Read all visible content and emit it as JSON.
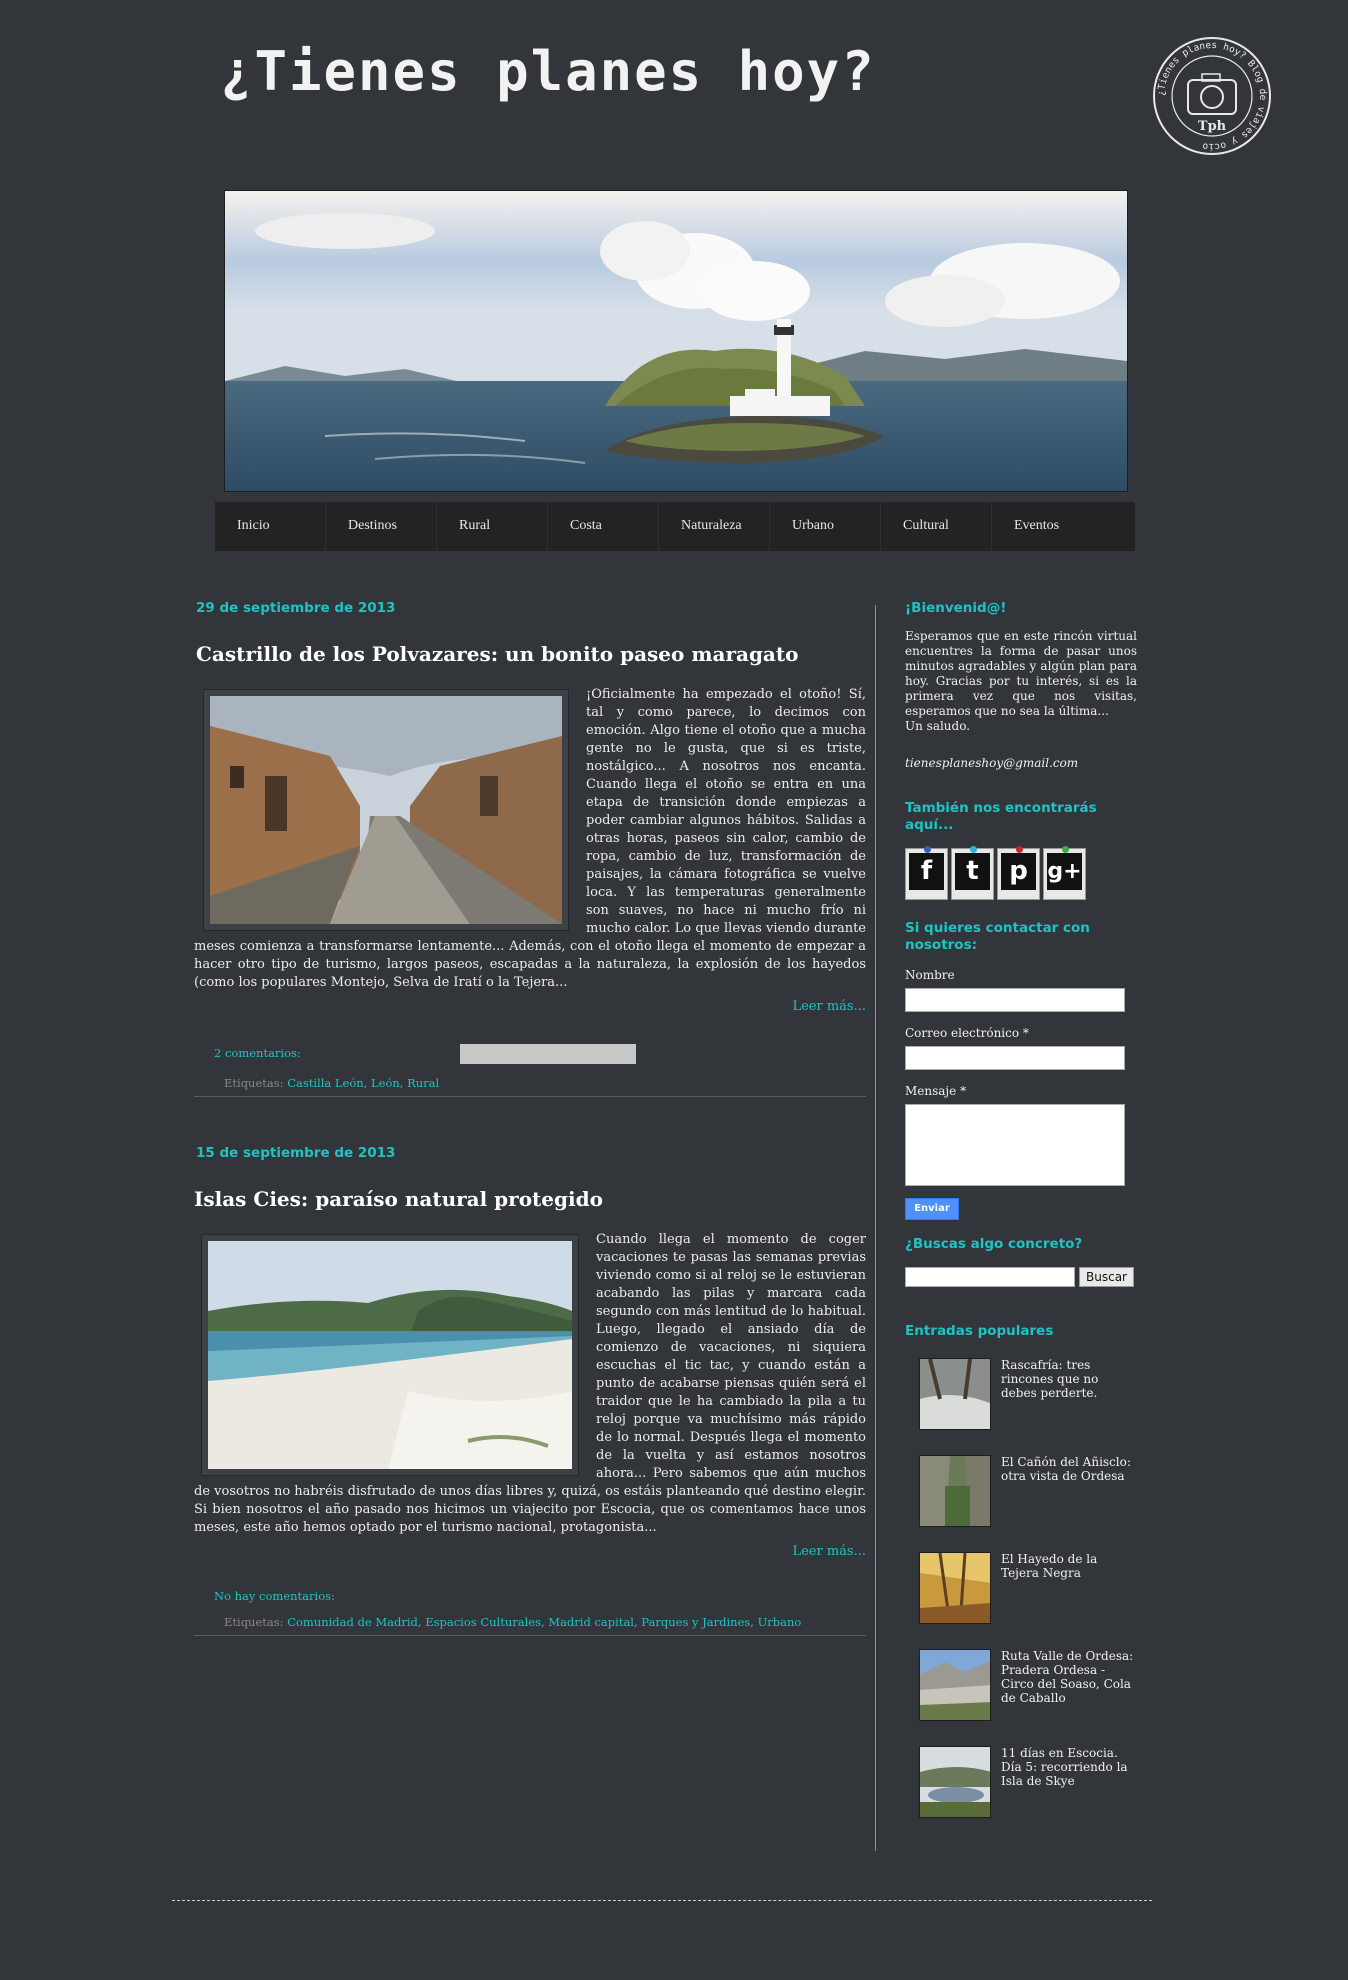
{
  "header": {
    "site_title": "¿Tienes planes hoy?",
    "logo": {
      "ring_text": "¿Tienes planes hoy? Blog de viajes y ocio",
      "center_text": "Tph"
    }
  },
  "nav": {
    "items": [
      "Inicio",
      "Destinos",
      "Rural",
      "Costa",
      "Naturaleza",
      "Urbano",
      "Cultural",
      "Eventos"
    ]
  },
  "posts": [
    {
      "date": "29 de septiembre de 2013",
      "title": "Castrillo de los Polvazares: un bonito paseo maragato",
      "body": "¡Oficialmente ha empezado el otoño! Sí, tal y como parece, lo decimos con emoción. Algo tiene el otoño que a mucha gente no le gusta, que si es triste, nostálgico... A nosotros nos encanta. Cuando llega el otoño se entra en una etapa de transición donde empiezas a poder cambiar algunos hábitos. Salidas a otras horas, paseos sin calor, cambio de ropa, cambio de luz, transformación de paisajes, la cámara fotográfica se vuelve loca. Y las temperaturas generalmente son suaves, no hace ni mucho frío ni mucho calor. Lo que llevas viendo durante meses comienza a transformarse lentamente... Además, con el otoño llega el momento de empezar a hacer otro tipo de turismo, largos paseos, escapadas a la naturaleza, la explosión de los hayedos (como los populares Montejo, Selva de Iratí o la Tejera...",
      "read_more": "Leer más...",
      "comments": "2 comentarios:",
      "labels_prefix": "Etiquetas:",
      "labels": [
        "Castilla León",
        "León",
        "Rural"
      ]
    },
    {
      "date": "15 de septiembre de 2013",
      "title": "Islas Cies: paraíso natural protegido",
      "body": "Cuando llega el momento de coger vacaciones te pasas las semanas previas viviendo como si al reloj se le estuvieran acabando las pilas y marcara cada segundo con más lentitud de lo habitual. Luego, llegado el ansiado día de comienzo de vacaciones, ni siquiera escuchas el tic tac, y cuando están a punto de acabarse piensas quién será el traidor que le ha cambiado la pila a tu reloj porque va muchísimo más rápido de lo normal. Después llega el momento de la vuelta y así estamos nosotros ahora... Pero sabemos que aún muchos de vosotros no habréis disfrutado de unos días libres y, quizá, os estáis planteando qué destino elegir. Si bien nosotros el año pasado nos hicimos un viajecito por Escocia, que os comentamos hace unos meses, este año hemos optado por el turismo nacional, protagonista...",
      "read_more": "Leer más...",
      "comments": "No hay comentarios:",
      "labels_prefix": "Etiquetas:",
      "labels": [
        "Comunidad de Madrid",
        "Espacios Culturales",
        "Madrid capital",
        "Parques y Jardines",
        "Urbano"
      ]
    }
  ],
  "sidebar": {
    "welcome": {
      "title": "¡Bienvenid@!",
      "text": "Esperamos que en este rincón virtual encuentres la forma de pasar unos minutos agradables y algún plan para hoy. Gracias por tu interés, si es la primera vez que nos visitas, esperamos que no sea la última...",
      "signoff": "Un saludo.",
      "email": "tienesplaneshoy@gmail.com"
    },
    "social": {
      "title": "También nos encontrarás aquí...",
      "items": [
        {
          "icon": "facebook-icon",
          "glyph": "f",
          "pin_color": "#3b5cc4"
        },
        {
          "icon": "twitter-icon",
          "glyph": "t",
          "pin_color": "#29b6d8"
        },
        {
          "icon": "pinterest-icon",
          "glyph": "p",
          "pin_color": "#c8242c"
        },
        {
          "icon": "google-plus-icon",
          "glyph": "g+",
          "pin_color": "#3fae3f"
        }
      ]
    },
    "contact": {
      "title": "Si quieres contactar con nosotros:",
      "name_label": "Nombre",
      "email_label": "Correo electrónico *",
      "message_label": "Mensaje *",
      "submit": "Enviar"
    },
    "search": {
      "title": "¿Buscas algo concreto?",
      "button": "Buscar"
    },
    "popular": {
      "title": "Entradas populares",
      "items": [
        "Rascafría: tres rincones que no debes perderte.",
        "El Cañón del Añisclo: otra vista de Ordesa",
        "El Hayedo de la Tejera Negra",
        "Ruta Valle de Ordesa: Pradera Ordesa - Circo del Soaso, Cola de Caballo",
        "11 días en Escocia. Día 5: recorriendo la Isla de Skye"
      ]
    }
  },
  "colors": {
    "accent": "#1ec4c4",
    "background": "#32363b",
    "nav": "#232323"
  }
}
